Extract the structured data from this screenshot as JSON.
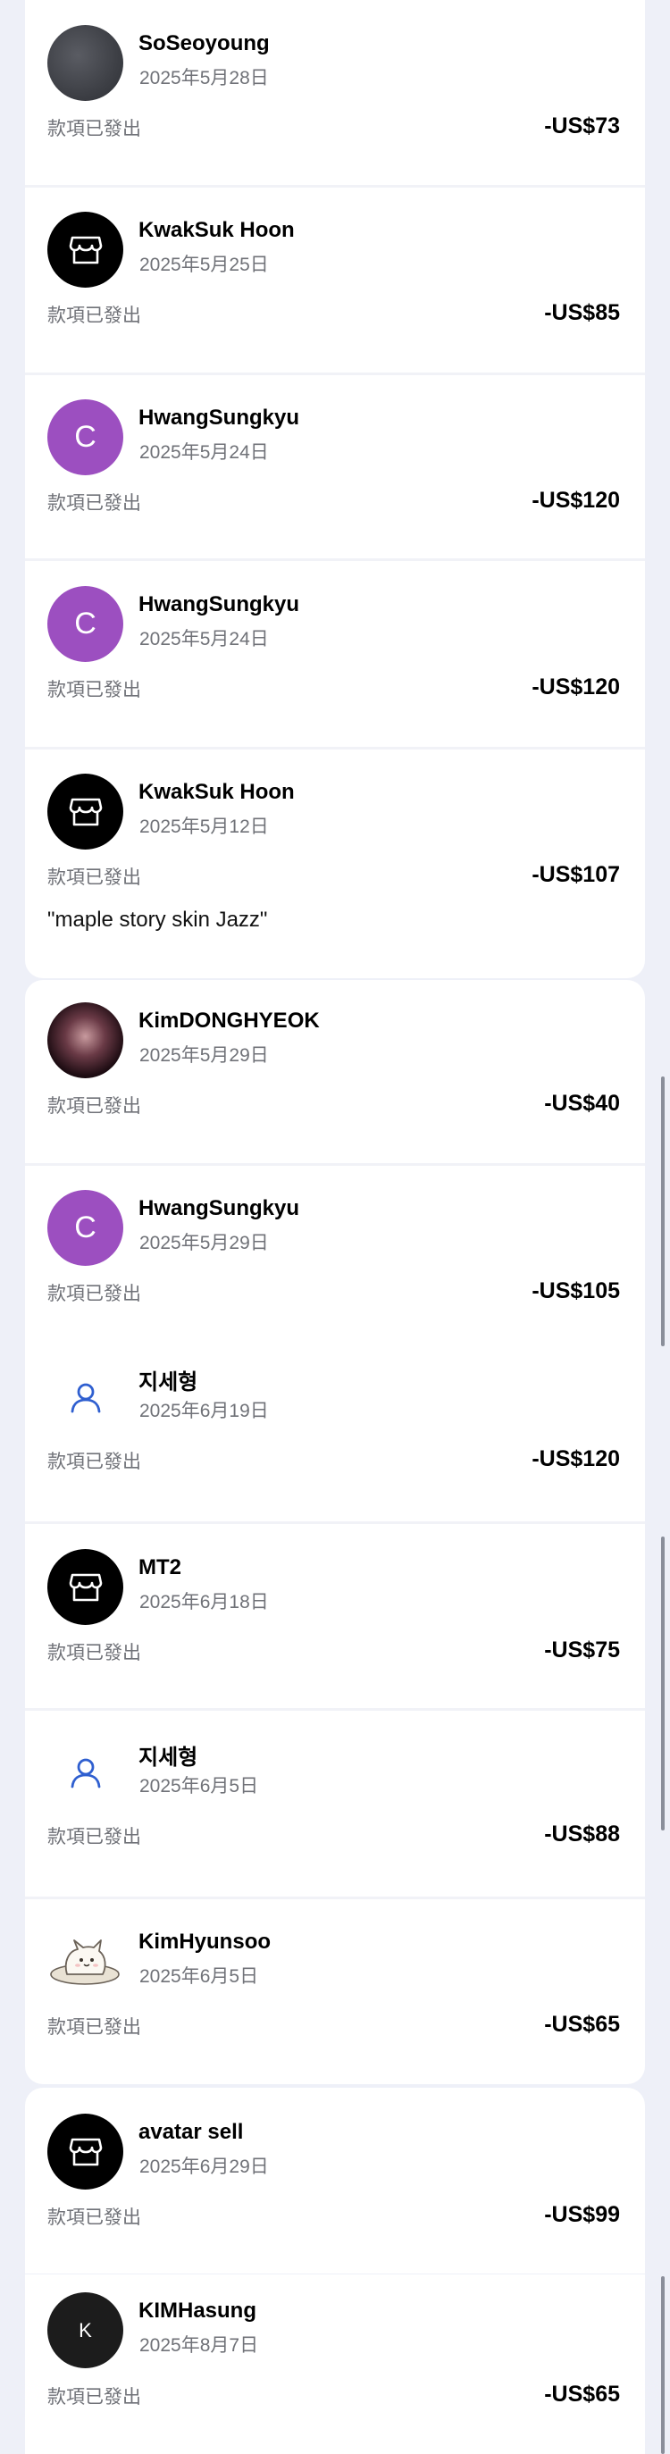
{
  "status_label": "款項已發出",
  "colors": {
    "background": "#eef0f8",
    "card": "#ffffff",
    "muted_text": "#707278",
    "avatar_purple": "#9c4fc0",
    "user_icon_blue": "#2f5fd0"
  },
  "groups": [
    {
      "transactions": [
        {
          "name": "SoSeoyoung",
          "date": "2025年5月28日",
          "status": "款項已發出",
          "amount": "-US$73",
          "avatar": "photo-gray"
        },
        {
          "name": "KwakSuk Hoon",
          "date": "2025年5月25日",
          "status": "款項已發出",
          "amount": "-US$85",
          "avatar": "store-icon"
        },
        {
          "name": "HwangSungkyu",
          "date": "2025年5月24日",
          "status": "款項已發出",
          "amount": "-US$120",
          "avatar": "letter",
          "avatar_letter": "C"
        },
        {
          "name": "HwangSungkyu",
          "date": "2025年5月24日",
          "status": "款項已發出",
          "amount": "-US$120",
          "avatar": "letter",
          "avatar_letter": "C"
        },
        {
          "name": "KwakSuk Hoon",
          "date": "2025年5月12日",
          "status": "款項已發出",
          "amount": "-US$107",
          "avatar": "store-icon",
          "note": "\"maple story skin Jazz\""
        }
      ]
    },
    {
      "transactions": [
        {
          "name": "KimDONGHYEOK",
          "date": "2025年5月29日",
          "status": "款項已發出",
          "amount": "-US$40",
          "avatar": "photo-person"
        },
        {
          "name": "HwangSungkyu",
          "date": "2025年5月29日",
          "status": "款項已發出",
          "amount": "-US$105",
          "avatar": "letter",
          "avatar_letter": "C"
        },
        {
          "name": "지세형",
          "date": "2025年6月19日",
          "status": "款項已發出",
          "amount": "-US$120",
          "avatar": "user-icon"
        },
        {
          "name": "MT2",
          "date": "2025年6月18日",
          "status": "款項已發出",
          "amount": "-US$75",
          "avatar": "store-icon"
        },
        {
          "name": "지세형",
          "date": "2025年6月5日",
          "status": "款項已發出",
          "amount": "-US$88",
          "avatar": "user-icon"
        },
        {
          "name": "KimHyunsoo",
          "date": "2025年6月5日",
          "status": "款項已發出",
          "amount": "-US$65",
          "avatar": "cat-sticker"
        }
      ]
    },
    {
      "transactions": [
        {
          "name": "avatar sell",
          "date": "2025年6月29日",
          "status": "款項已發出",
          "amount": "-US$99",
          "avatar": "store-icon"
        }
      ]
    },
    {
      "transactions": [
        {
          "name": "KIMHasung",
          "date": "2025年8月7日",
          "status": "款項已發出",
          "amount": "-US$65",
          "avatar": "letter",
          "avatar_letter": "K"
        }
      ]
    }
  ]
}
